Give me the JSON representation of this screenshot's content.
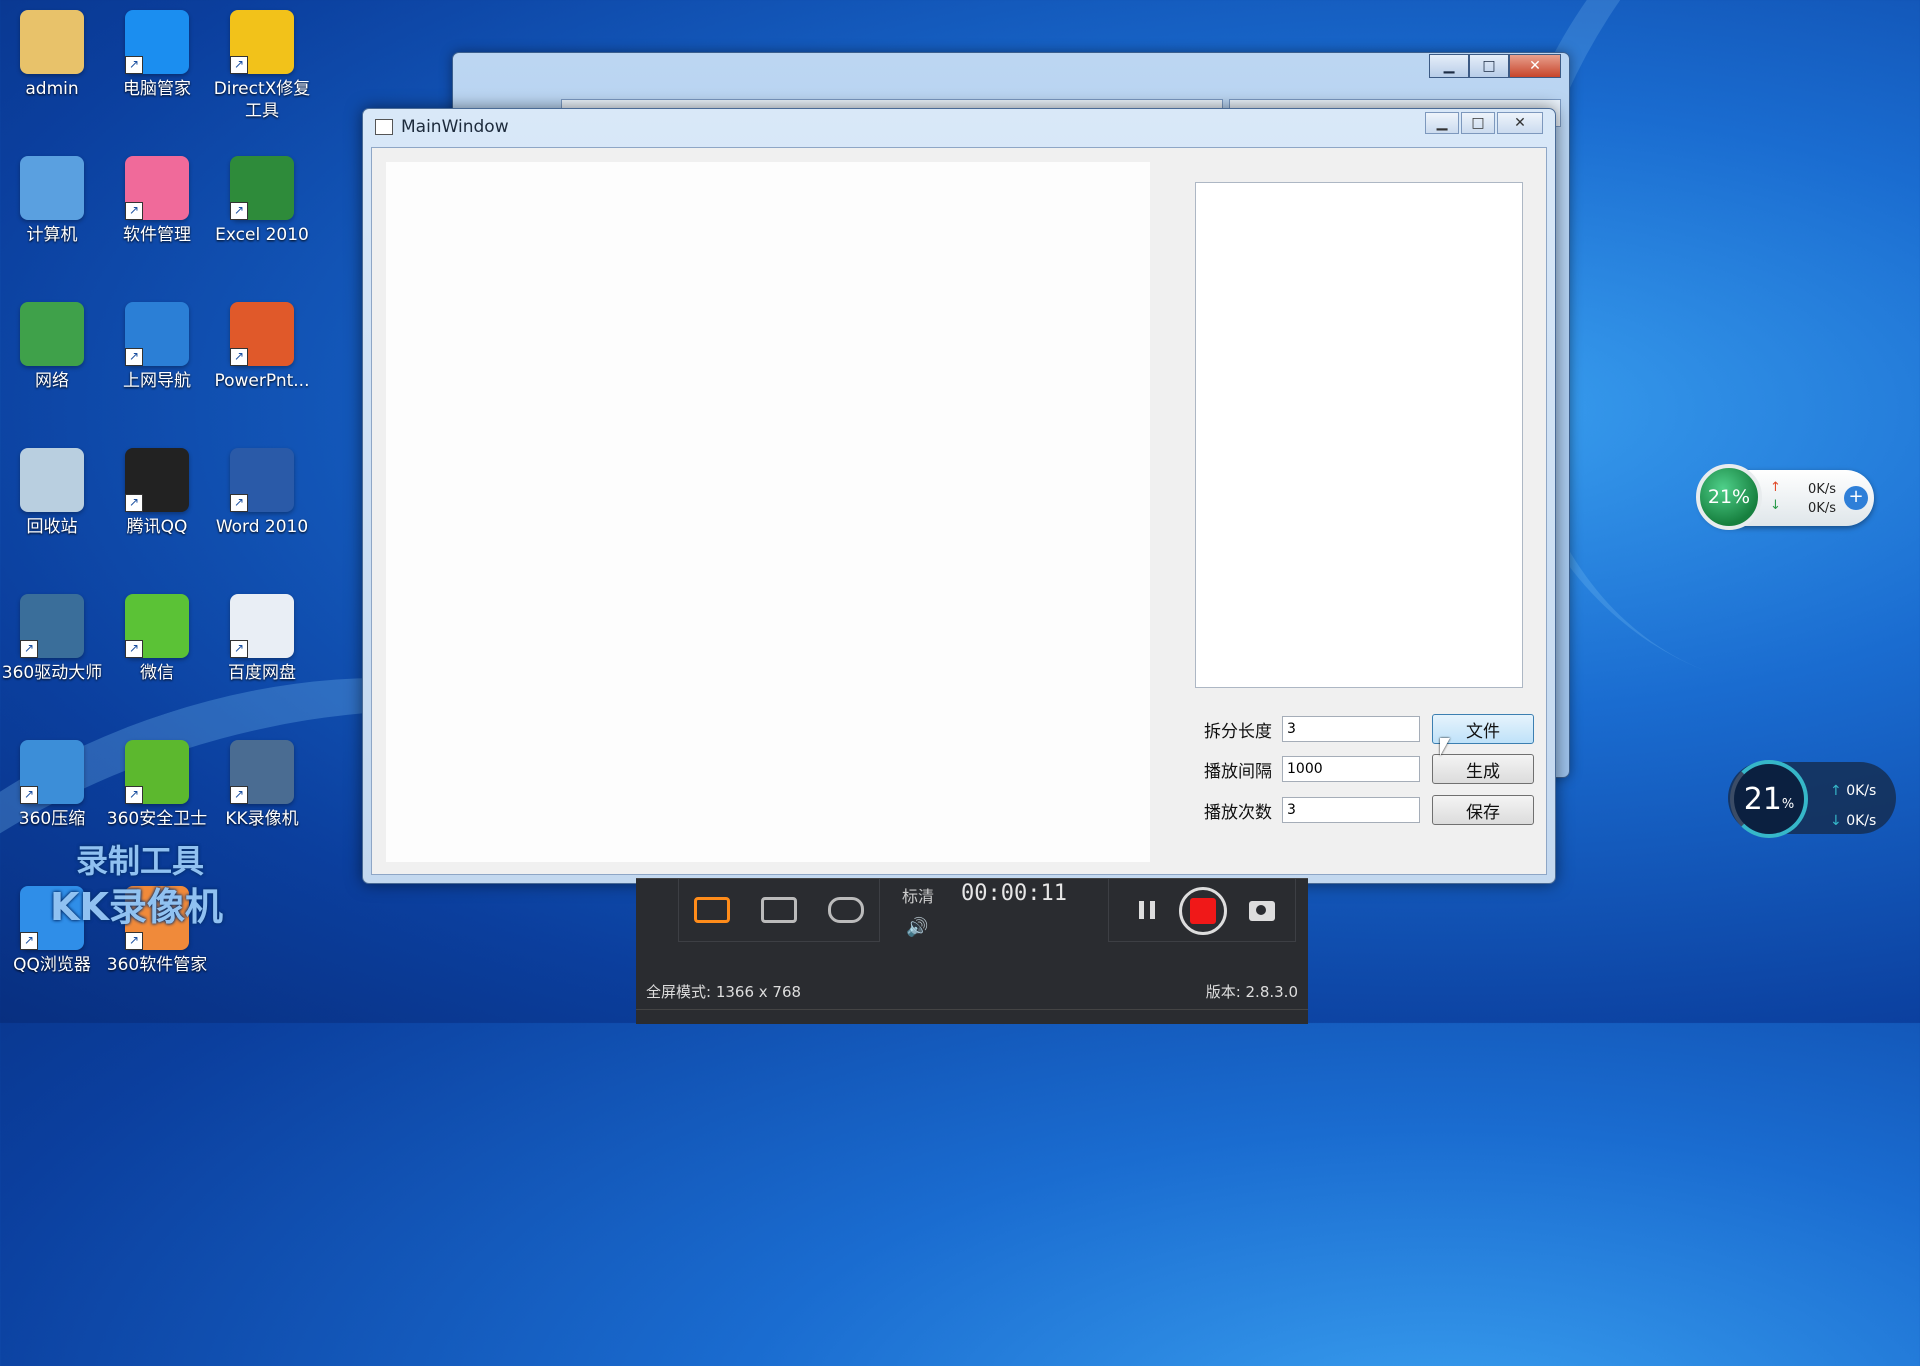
{
  "desktop": {
    "icons": [
      {
        "label": "admin",
        "icon": "user-folder-icon",
        "color": "#e8c26a"
      },
      {
        "label": "电脑管家",
        "icon": "shield-icon",
        "color": "#1b8ef0"
      },
      {
        "label": "DirectX修复工具",
        "icon": "directx-icon",
        "color": "#f2c21a"
      },
      {
        "label": "计算机",
        "icon": "computer-icon",
        "color": "#5aa0e0"
      },
      {
        "label": "软件管理",
        "icon": "software-manager-icon",
        "color": "#f06a9a"
      },
      {
        "label": "Excel 2010",
        "icon": "excel-icon",
        "color": "#2e8b3a"
      },
      {
        "label": "网络",
        "icon": "network-globe-icon",
        "color": "#3fa14a"
      },
      {
        "label": "上网导航",
        "icon": "ie-browser-icon",
        "color": "#2b7fd6"
      },
      {
        "label": "PowerPnt...",
        "icon": "powerpoint-icon",
        "color": "#e0592a"
      },
      {
        "label": "回收站",
        "icon": "recycle-bin-icon",
        "color": "#b9cfe0"
      },
      {
        "label": "腾讯QQ",
        "icon": "qq-penguin-icon",
        "color": "#222222"
      },
      {
        "label": "Word 2010",
        "icon": "word-icon",
        "color": "#2a5aa8"
      },
      {
        "label": "360驱动大师",
        "icon": "driver-gear-icon",
        "color": "#3a6e9a"
      },
      {
        "label": "微信",
        "icon": "wechat-icon",
        "color": "#5bc236"
      },
      {
        "label": "百度网盘",
        "icon": "baidu-netdisk-icon",
        "color": "#e9eef5"
      },
      {
        "label": "360压缩",
        "icon": "archive-icon",
        "color": "#3c8ed8"
      },
      {
        "label": "360安全卫士",
        "icon": "360-guard-icon",
        "color": "#5cb82e"
      },
      {
        "label": "KK录像机",
        "icon": "kk-recorder-icon",
        "color": "#4a6c92"
      },
      {
        "label": "QQ浏览器",
        "icon": "qq-browser-icon",
        "color": "#2f8ee8"
      },
      {
        "label": "360软件管家",
        "icon": "360-software-icon",
        "color": "#f08a3a"
      }
    ]
  },
  "watermark": {
    "line1": "录制工具",
    "line2": "KK录像机"
  },
  "main_window": {
    "title": "MainWindow",
    "controls": {
      "minimize": "▁",
      "maximize": "□",
      "close": "✕"
    },
    "form": {
      "split_length_label": "拆分长度",
      "split_length_value": "3",
      "interval_label": "播放间隔",
      "interval_value": "1000",
      "count_label": "播放次数",
      "count_value": "3",
      "file_button": "文件",
      "generate_button": "生成",
      "save_button": "保存"
    }
  },
  "background_window": {
    "controls": {
      "minimize": "▁",
      "maximize": "□",
      "close": "✕"
    }
  },
  "recorder": {
    "quality": "标清",
    "timer": "00:00:11",
    "mode_text": "全屏模式: 1366 x 768",
    "version_text": "版本: 2.8.3.0"
  },
  "net_widget_1": {
    "percent": "21%",
    "up": "0K/s",
    "down": "0K/s"
  },
  "net_widget_2": {
    "percent": "21",
    "unit": "%",
    "up": "0K/s",
    "down": "0K/s"
  }
}
